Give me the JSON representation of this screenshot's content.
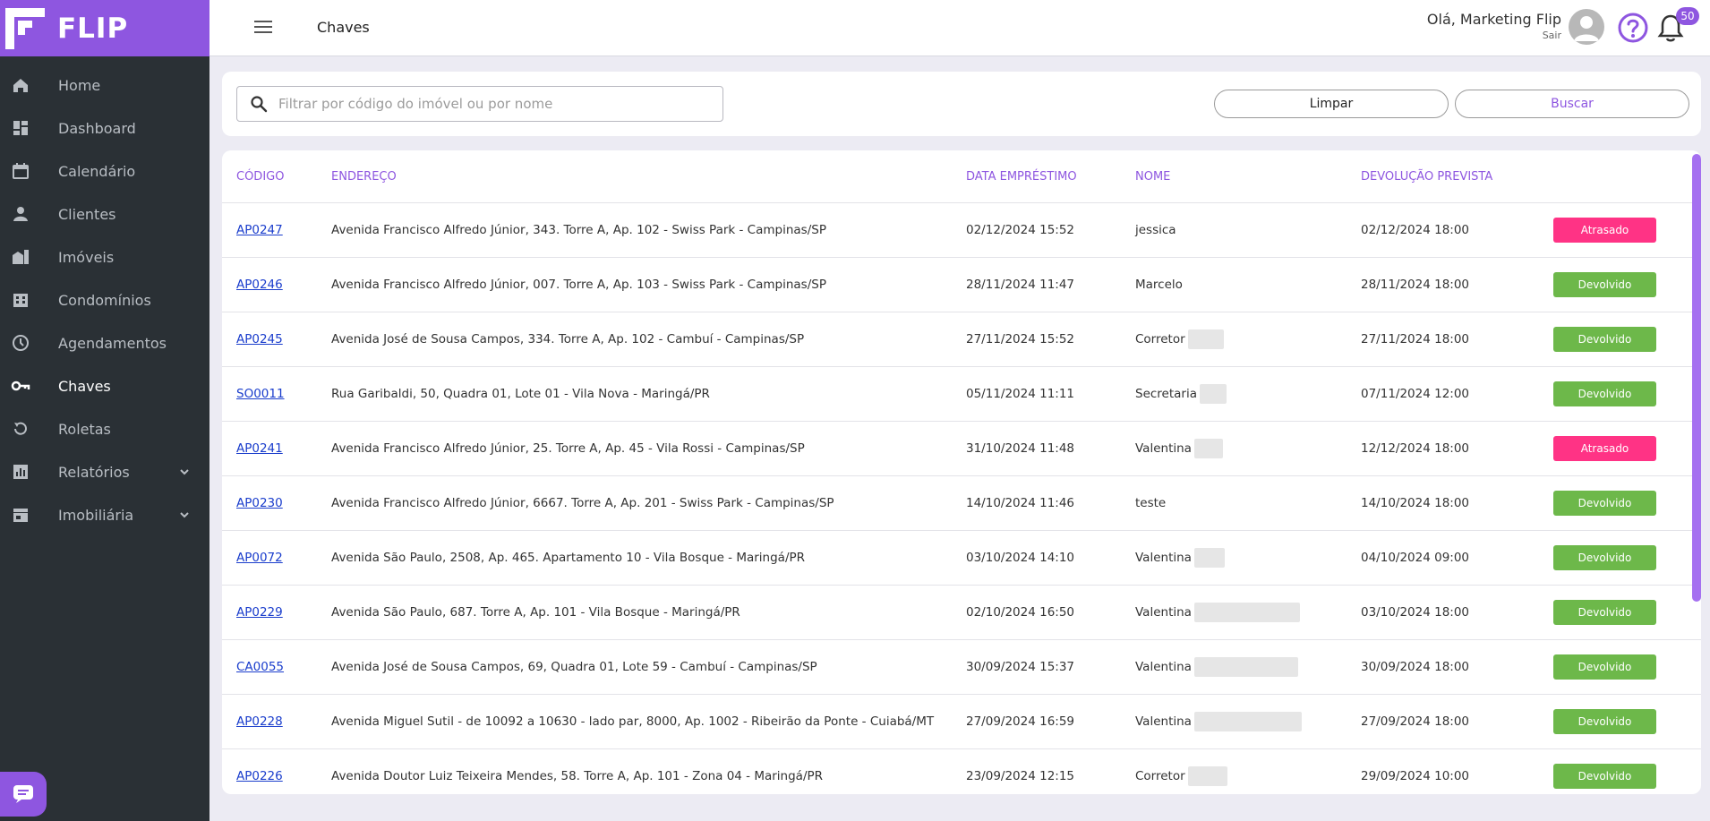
{
  "brand": {
    "name": "FLIP",
    "color": "#8e56e0"
  },
  "sidebar": {
    "items": [
      {
        "label": "Home",
        "icon": "home-icon"
      },
      {
        "label": "Dashboard",
        "icon": "dashboard-icon"
      },
      {
        "label": "Calendário",
        "icon": "calendar-icon"
      },
      {
        "label": "Clientes",
        "icon": "person-icon"
      },
      {
        "label": "Imóveis",
        "icon": "buildings-icon"
      },
      {
        "label": "Condomínios",
        "icon": "condo-icon"
      },
      {
        "label": "Agendamentos",
        "icon": "clock-icon"
      },
      {
        "label": "Chaves",
        "icon": "key-icon",
        "active": true
      },
      {
        "label": "Roletas",
        "icon": "rotate-icon"
      },
      {
        "label": "Relatórios",
        "icon": "chart-icon",
        "expandable": true
      },
      {
        "label": "Imobiliária",
        "icon": "store-icon",
        "expandable": true
      }
    ]
  },
  "header": {
    "title": "Chaves",
    "greeting": "Olá, Marketing Flip",
    "logout": "Sair",
    "notifications_count": "50"
  },
  "filter": {
    "placeholder": "Filtrar por código do imóvel ou por nome",
    "clear_label": "Limpar",
    "search_label": "Buscar"
  },
  "table": {
    "columns": {
      "code": "CÓDIGO",
      "address": "ENDEREÇO",
      "loan_date": "DATA EMPRÉSTIMO",
      "name": "NOME",
      "return_date": "DEVOLUÇÃO PREVISTA"
    },
    "rows": [
      {
        "code": "AP0247",
        "address": "Avenida Francisco Alfredo Júnior, 343. Torre A, Ap. 102 - Swiss Park - Campinas/SP",
        "loan_date": "02/12/2024 15:52",
        "name": "jessica",
        "redacted": 0,
        "return_date": "02/12/2024 18:00",
        "status": "Atrasado",
        "late": true
      },
      {
        "code": "AP0246",
        "address": "Avenida Francisco Alfredo Júnior, 007. Torre A, Ap. 103 - Swiss Park - Campinas/SP",
        "loan_date": "28/11/2024 11:47",
        "name": "Marcelo",
        "redacted": 0,
        "return_date": "28/11/2024 18:00",
        "status": "Devolvido",
        "late": false
      },
      {
        "code": "AP0245",
        "address": "Avenida José de Sousa Campos, 334. Torre A, Ap. 102 - Cambuí - Campinas/SP",
        "loan_date": "27/11/2024 15:52",
        "name": "Corretor",
        "redacted": 40,
        "return_date": "27/11/2024 18:00",
        "status": "Devolvido",
        "late": false
      },
      {
        "code": "SO0011",
        "address": "Rua Garibaldi, 50, Quadra 01, Lote 01 - Vila Nova - Maringá/PR",
        "loan_date": "05/11/2024 11:11",
        "name": "Secretaria",
        "redacted": 30,
        "return_date": "07/11/2024 12:00",
        "status": "Devolvido",
        "late": false
      },
      {
        "code": "AP0241",
        "address": "Avenida Francisco Alfredo Júnior, 25. Torre A, Ap. 45 - Vila Rossi - Campinas/SP",
        "loan_date": "31/10/2024 11:48",
        "name": "Valentina",
        "redacted": 32,
        "return_date": "12/12/2024 18:00",
        "status": "Atrasado",
        "late": true
      },
      {
        "code": "AP0230",
        "address": "Avenida Francisco Alfredo Júnior, 6667. Torre A, Ap. 201 - Swiss Park - Campinas/SP",
        "loan_date": "14/10/2024 11:46",
        "name": "teste",
        "redacted": 0,
        "return_date": "14/10/2024 18:00",
        "status": "Devolvido",
        "late": false
      },
      {
        "code": "AP0072",
        "address": "Avenida São Paulo, 2508, Ap. 465. Apartamento 10 - Vila Bosque - Maringá/PR",
        "loan_date": "03/10/2024 14:10",
        "name": "Valentina",
        "redacted": 34,
        "return_date": "04/10/2024 09:00",
        "status": "Devolvido",
        "late": false
      },
      {
        "code": "AP0229",
        "address": "Avenida São Paulo, 687. Torre A, Ap. 101 - Vila Bosque - Maringá/PR",
        "loan_date": "02/10/2024 16:50",
        "name": "Valentina",
        "redacted": 118,
        "return_date": "03/10/2024 18:00",
        "status": "Devolvido",
        "late": false
      },
      {
        "code": "CA0055",
        "address": "Avenida José de Sousa Campos, 69, Quadra 01, Lote 59 - Cambuí - Campinas/SP",
        "loan_date": "30/09/2024 15:37",
        "name": "Valentina",
        "redacted": 116,
        "return_date": "30/09/2024 18:00",
        "status": "Devolvido",
        "late": false
      },
      {
        "code": "AP0228",
        "address": "Avenida Miguel Sutil - de 10092 a 10630 - lado par, 8000, Ap. 1002 - Ribeirão da Ponte - Cuiabá/MT",
        "loan_date": "27/09/2024 16:59",
        "name": "Valentina",
        "redacted": 120,
        "return_date": "27/09/2024 18:00",
        "status": "Devolvido",
        "late": false
      },
      {
        "code": "AP0226",
        "address": "Avenida Doutor Luiz Teixeira Mendes, 58. Torre A, Ap. 101 - Zona 04 - Maringá/PR",
        "loan_date": "23/09/2024 12:15",
        "name": "Corretor",
        "redacted": 44,
        "return_date": "29/09/2024 10:00",
        "status": "Devolvido",
        "late": false
      }
    ]
  },
  "colors": {
    "late": "#ff3385",
    "returned": "#6db84a",
    "link": "#1a3dcc",
    "sidebar_bg": "#2a3035"
  }
}
